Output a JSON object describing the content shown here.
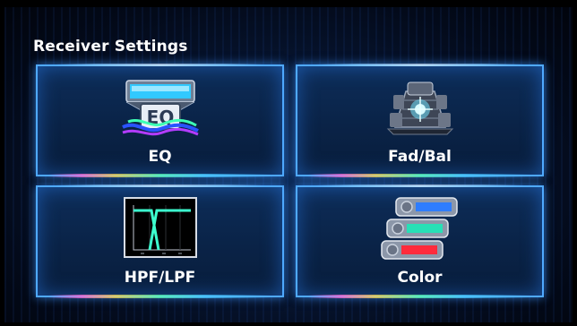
{
  "header": {
    "title": "Receiver Settings"
  },
  "tiles": [
    {
      "label": "EQ",
      "icon": "eq-icon"
    },
    {
      "label": "Fad/Bal",
      "icon": "fader-balance-icon"
    },
    {
      "label": "HPF/LPF",
      "icon": "filter-graph-icon"
    },
    {
      "label": "Color",
      "icon": "color-sliders-icon"
    }
  ],
  "colors": {
    "tile_border": "#4fa9ff",
    "color_bar_1": "#2e7dff",
    "color_bar_2": "#27e0b6",
    "color_bar_3": "#ff2b3c"
  }
}
